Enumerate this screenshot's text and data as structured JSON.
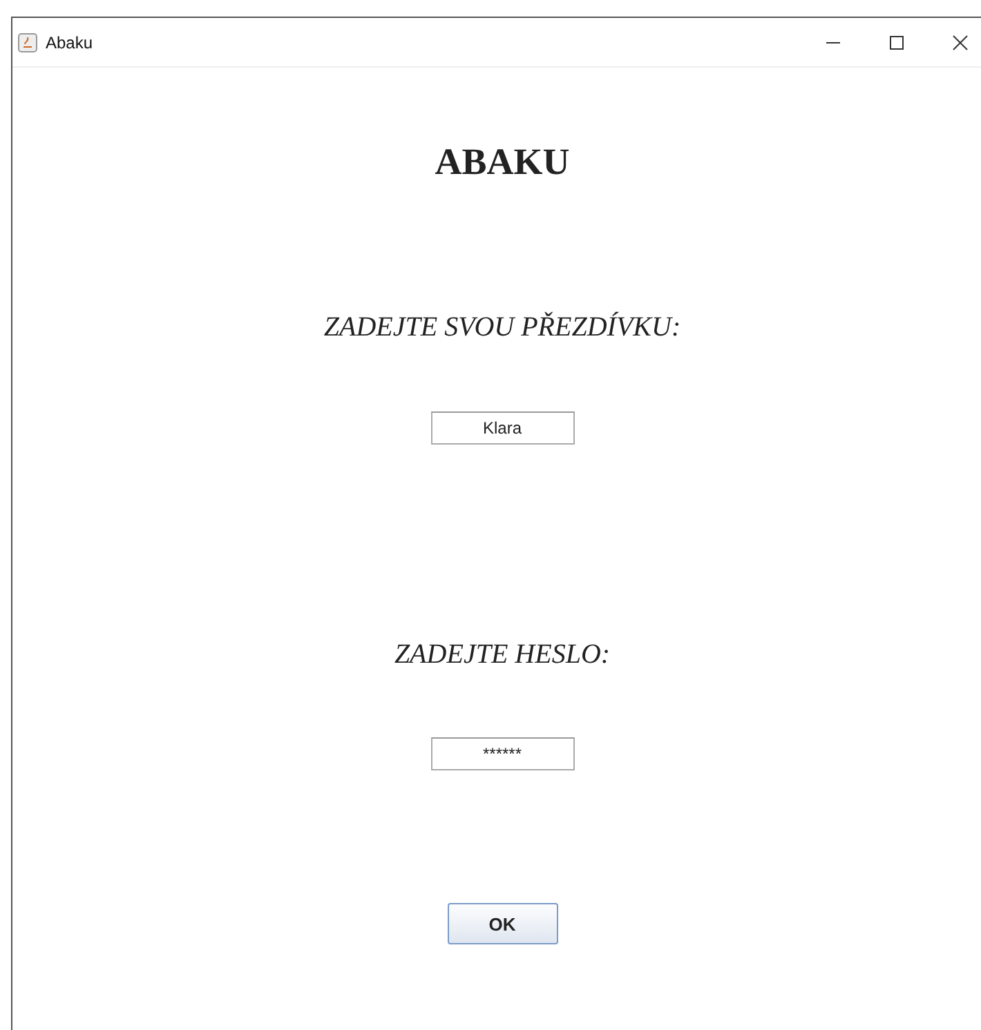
{
  "window": {
    "title": "Abaku"
  },
  "heading": "ABAKU",
  "nickname": {
    "label": "ZADEJTE SVOU PŘEZDÍVKU:",
    "value": "Klara"
  },
  "password": {
    "label": "ZADEJTE HESLO:",
    "value": "******"
  },
  "buttons": [
    "OK"
  ]
}
